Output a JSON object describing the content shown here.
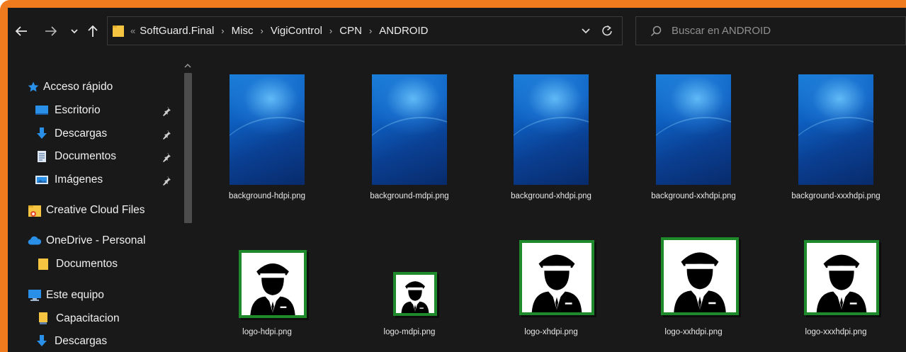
{
  "toolbar": {
    "breadcrumb_overflow": "«",
    "breadcrumbs": [
      "SoftGuard.Final",
      "Misc",
      "VigiControl",
      "CPN",
      "ANDROID"
    ],
    "search_placeholder": "Buscar en ANDROID"
  },
  "sidebar": {
    "quick_access": "Acceso rápido",
    "items": [
      {
        "label": "Escritorio",
        "icon": "desktop-icon",
        "pinned": true
      },
      {
        "label": "Descargas",
        "icon": "download-icon",
        "pinned": true
      },
      {
        "label": "Documentos",
        "icon": "documents-icon",
        "pinned": true
      },
      {
        "label": "Imágenes",
        "icon": "pictures-icon",
        "pinned": true
      }
    ],
    "creative_cloud": "Creative Cloud Files",
    "onedrive": "OneDrive - Personal",
    "onedrive_items": [
      {
        "label": "Documentos",
        "icon": "folder-icon"
      }
    ],
    "this_pc": "Este equipo",
    "this_pc_items": [
      {
        "label": "Capacitacion",
        "icon": "folder-icon"
      },
      {
        "label": "Descargas",
        "icon": "download-icon"
      }
    ]
  },
  "files": [
    {
      "name": "background-hdpi.png",
      "kind": "background"
    },
    {
      "name": "background-mdpi.png",
      "kind": "background"
    },
    {
      "name": "background-xhdpi.png",
      "kind": "background"
    },
    {
      "name": "background-xxhdpi.png",
      "kind": "background"
    },
    {
      "name": "background-xxxhdpi.png",
      "kind": "background"
    },
    {
      "name": "logo-hdpi.png",
      "kind": "logo"
    },
    {
      "name": "logo-mdpi.png",
      "kind": "logo"
    },
    {
      "name": "logo-xhdpi.png",
      "kind": "logo"
    },
    {
      "name": "logo-xxhdpi.png",
      "kind": "logo"
    },
    {
      "name": "logo-xxxhdpi.png",
      "kind": "logo"
    }
  ],
  "colors": {
    "window_border": "#f07a1e",
    "background": "#191919",
    "logo_border": "#1f8a2c",
    "folder": "#f5c542",
    "accent_blue": "#2a8fe6"
  }
}
